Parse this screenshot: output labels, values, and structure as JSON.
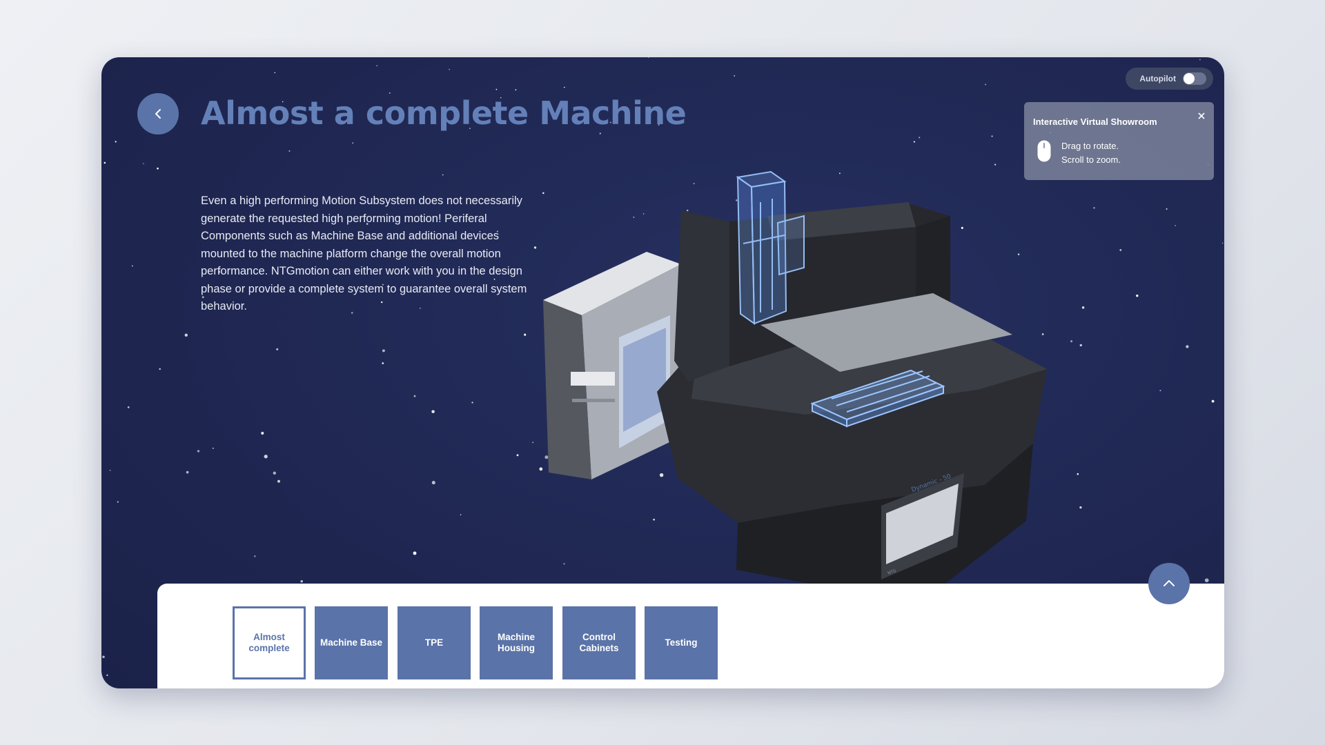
{
  "header": {
    "title": "Almost a complete Machine"
  },
  "description": "Even a high performing Motion Subsystem does not necessarily generate the requested high performing motion! Periferal Components such as Machine Base and additional devices mounted to the machine platform change the overall motion performance. NTGmotion can either work with you in the design phase or provide a complete system to guarantee overall system behavior.",
  "autopilot": {
    "label": "Autopilot",
    "enabled": false
  },
  "info_panel": {
    "title": "Interactive Virtual Showroom",
    "hint_rotate": "Drag to rotate.",
    "hint_zoom": "Scroll to zoom."
  },
  "machine_model": {
    "housing_label": "Dynamic - 50",
    "panel_label": "NTG"
  },
  "tabs": [
    {
      "label": "Almost complete",
      "active": true
    },
    {
      "label": "Machine Base",
      "active": false
    },
    {
      "label": "TPE",
      "active": false
    },
    {
      "label": "Machine Housing",
      "active": false
    },
    {
      "label": "Control Cabinets",
      "active": false
    },
    {
      "label": "Testing",
      "active": false
    }
  ],
  "icons": {
    "back": "chevron-left-icon",
    "up": "chevron-up-icon",
    "close": "close-icon",
    "mouse": "mouse-icon"
  },
  "colors": {
    "accent": "#5a73a8",
    "title": "#6480b8",
    "background": "#1f2752",
    "panel": "#ffffff"
  }
}
